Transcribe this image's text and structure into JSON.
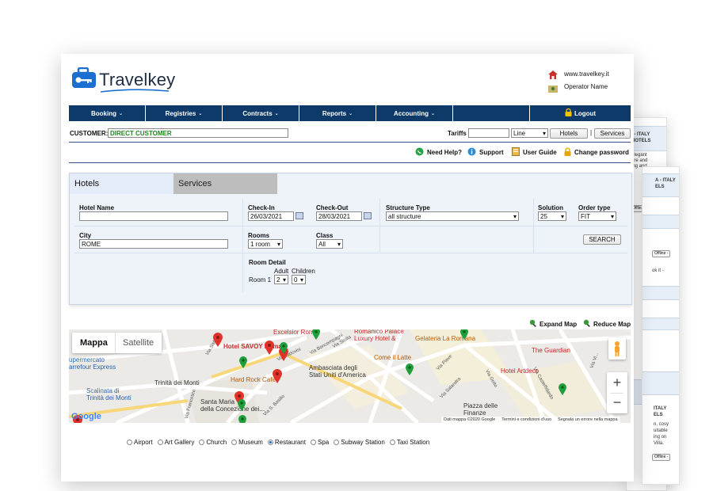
{
  "bg_pages": {
    "p1_lines": [
      "I - ITALY",
      "HOTELS"
    ],
    "p1_desc": [
      "elegant",
      "ure and",
      "ing and",
      "s"
    ],
    "p2_lines": [
      "A - ITALY",
      "ELS"
    ],
    "p3_desc": [
      "ok it -"
    ],
    "p4_desc": [
      "ITALY",
      "ELS",
      "n, cosy",
      "uitable",
      "ing on",
      "Villa."
    ],
    "offline": "Offline -"
  },
  "brand": {
    "name": "Travelkey"
  },
  "header": {
    "site": "www.travelkey.it",
    "operator": "Operator Name"
  },
  "nav": {
    "items": [
      "Booking",
      "Registries",
      "Contracts",
      "Reports",
      "Accounting"
    ],
    "logout": "Logout"
  },
  "customer": {
    "label": "CUSTOMER:",
    "value": "DIRECT CUSTOMER"
  },
  "tariffs": {
    "label": "Tariffs",
    "line_value": "Line",
    "hotels_btn": "Hotels",
    "sep": "|",
    "services_btn": "Services"
  },
  "help": {
    "need_help": "Need Help?",
    "support": "Support",
    "user_guide": "User Guide",
    "change_password": "Change password"
  },
  "search": {
    "tabs": [
      "Hotels",
      "Services"
    ],
    "hotel_name_label": "Hotel Name",
    "checkin_label": "Check-In",
    "checkin_value": "26/03/2021",
    "checkout_label": "Check-Out",
    "checkout_value": "28/03/2021",
    "structure_label": "Structure Type",
    "structure_value": "all structure",
    "solution_label": "Solution",
    "solution_value": "25",
    "order_label": "Order type",
    "order_value": "FIT",
    "city_label": "City",
    "city_value": "ROME",
    "rooms_label": "Rooms",
    "rooms_value": "1 room",
    "class_label": "Class",
    "class_value": "All",
    "search_btn": "SEARCH",
    "room_detail_label": "Room Detail",
    "adult_label": "Adult",
    "children_label": "Children",
    "room1_label": "Room 1",
    "adult_value": "2",
    "children_value": "0"
  },
  "map": {
    "expand": "Expand Map",
    "reduce": "Reduce Map",
    "type_map": "Mappa",
    "type_satellite": "Satellite",
    "labels": {
      "hotel_savoy": "Hotel SAVOY Roma",
      "excelsior": "Excelsior Rom",
      "romanico": "Romanico Palace\nLuxury Hotel &",
      "gelateria": "Gelateria La Romana",
      "the_guardian": "The Guardian",
      "ambasciata": "Ambasciata degli\nStati Uniti d'America",
      "come_il_latte": "Come il Latte",
      "hotel_artdeco": "Hotel Artdeco",
      "hard_rock": "Hard Rock Cafe",
      "supermercato": "upermercato\narrefour Express",
      "scalinata": "Scalinata di\nTrinità dei Monti",
      "trinita": "Trinità dei Monti",
      "santa_maria": "Santa Maria\ndella Concezione dei...",
      "piazza": "Piazza delle\nFinanze",
      "via_ludovisi": "Via Ludovisi",
      "via_boncompagni": "Via Boncompagni",
      "via_piave": "Via Piave",
      "via_goito": "Via Goito",
      "via_castelfidardo": "Via Castelfidardo",
      "via_sicilia": "Via Sicilia",
      "via_francesco": "Via Francesco",
      "via_basilio": "Via S. Basilio",
      "via_sistina": "Via Sistina",
      "via_salandra": "Via Salandra",
      "via_vicenza": "Via Vi..."
    },
    "google": "Google",
    "footer": [
      "Dati mappa ©2020 Google",
      "Termini e condizioni d'uso",
      "Segnala un errore nella mappa"
    ],
    "zoom_in": "+",
    "zoom_out": "−"
  },
  "poi": [
    "Airport",
    "Art Gallery",
    "Church",
    "Museum",
    "Restaurant",
    "Spa",
    "Subway Station",
    "Taxi Station"
  ],
  "poi_selected": "Restaurant",
  "colors": {
    "nav": "#0e3a6a",
    "accent": "#1a62d0",
    "pin_red": "#e0322b",
    "pin_green": "#1f9e3a"
  }
}
